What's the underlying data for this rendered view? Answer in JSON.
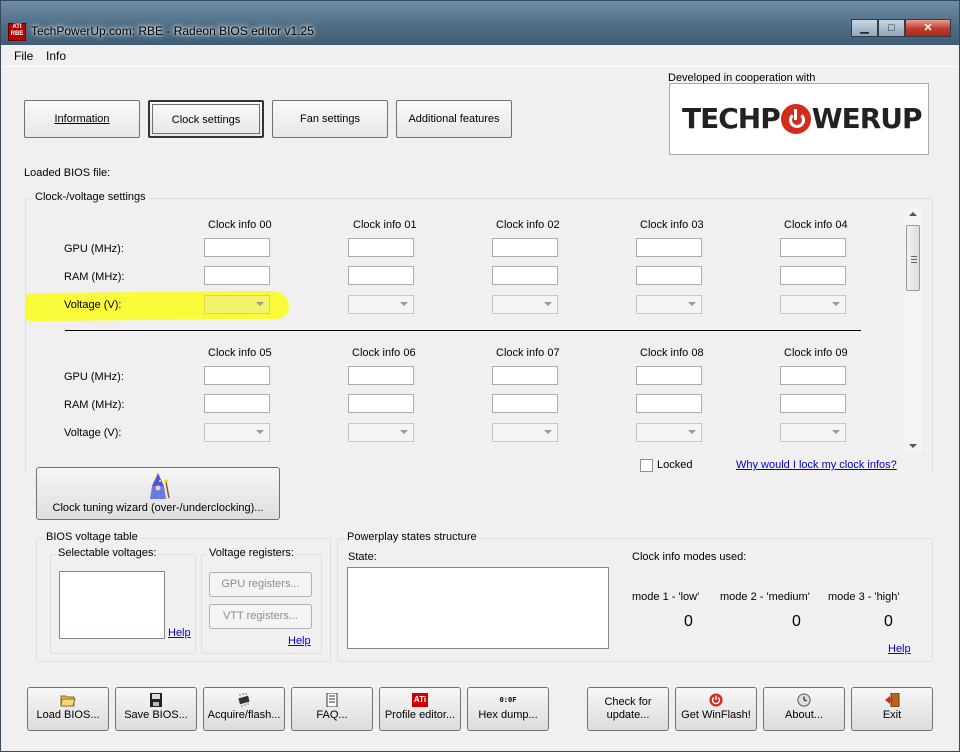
{
  "window": {
    "title": "TechPowerUp.com: RBE - Radeon BIOS editor v1.25",
    "app_icon_text": "ATI RBE",
    "minimize": "▁",
    "maximize": "□",
    "close": "✕"
  },
  "menu": {
    "file": "File",
    "info": "Info"
  },
  "tabs": {
    "information": "Information",
    "clock_settings": "Clock settings",
    "fan_settings": "Fan settings",
    "additional_features": "Additional features"
  },
  "logo": {
    "caption": "Developed in cooperation with",
    "text_left": "TECHP",
    "text_right": "WERUP"
  },
  "loaded_bios_label": "Loaded BIOS file:",
  "clock_group": {
    "title": "Clock-/voltage settings",
    "row_labels": {
      "gpu": "GPU (MHz):",
      "ram": "RAM (MHz):",
      "voltage": "Voltage (V):"
    },
    "top_headers": [
      "Clock info 00",
      "Clock info 01",
      "Clock info 02",
      "Clock info 03",
      "Clock info 04"
    ],
    "bottom_headers": [
      "Clock info 05",
      "Clock info 06",
      "Clock info 07",
      "Clock info 08",
      "Clock info 09"
    ],
    "locked_label": "Locked",
    "lock_link": "Why would I lock my clock infos?"
  },
  "wizard_button": "Clock tuning wizard (over-/underclocking)...",
  "bios_voltage": {
    "title": "BIOS voltage table",
    "selectable": "Selectable voltages:",
    "registers": "Voltage registers:",
    "gpu_registers": "GPU registers...",
    "vtt_registers": "VTT registers...",
    "help1": "Help",
    "help2": "Help"
  },
  "powerplay": {
    "title": "Powerplay states structure",
    "state": "State:",
    "modes_used": "Clock info modes used:",
    "mode1": "mode 1 - 'low'",
    "mode2": "mode 2 - 'medium'",
    "mode3": "mode 3 - 'high'",
    "val1": "0",
    "val2": "0",
    "val3": "0",
    "help": "Help"
  },
  "toolbar": {
    "load_bios": "Load BIOS...",
    "save_bios": "Save BIOS...",
    "acquire_flash": "Acquire/flash...",
    "faq": "FAQ...",
    "profile_editor": "Profile editor...",
    "hex_dump": "Hex dump...",
    "check_update_line1": "Check for",
    "check_update_line2": "update...",
    "get_winflash": "Get WinFlash!",
    "about": "About...",
    "exit": "Exit",
    "ati_icon_text": "ATi",
    "hex_icon_text": "0:0F"
  },
  "colors": {
    "highlight": "#f9fb3a",
    "link": "#0000cc",
    "logo_red": "#d52b1e"
  }
}
